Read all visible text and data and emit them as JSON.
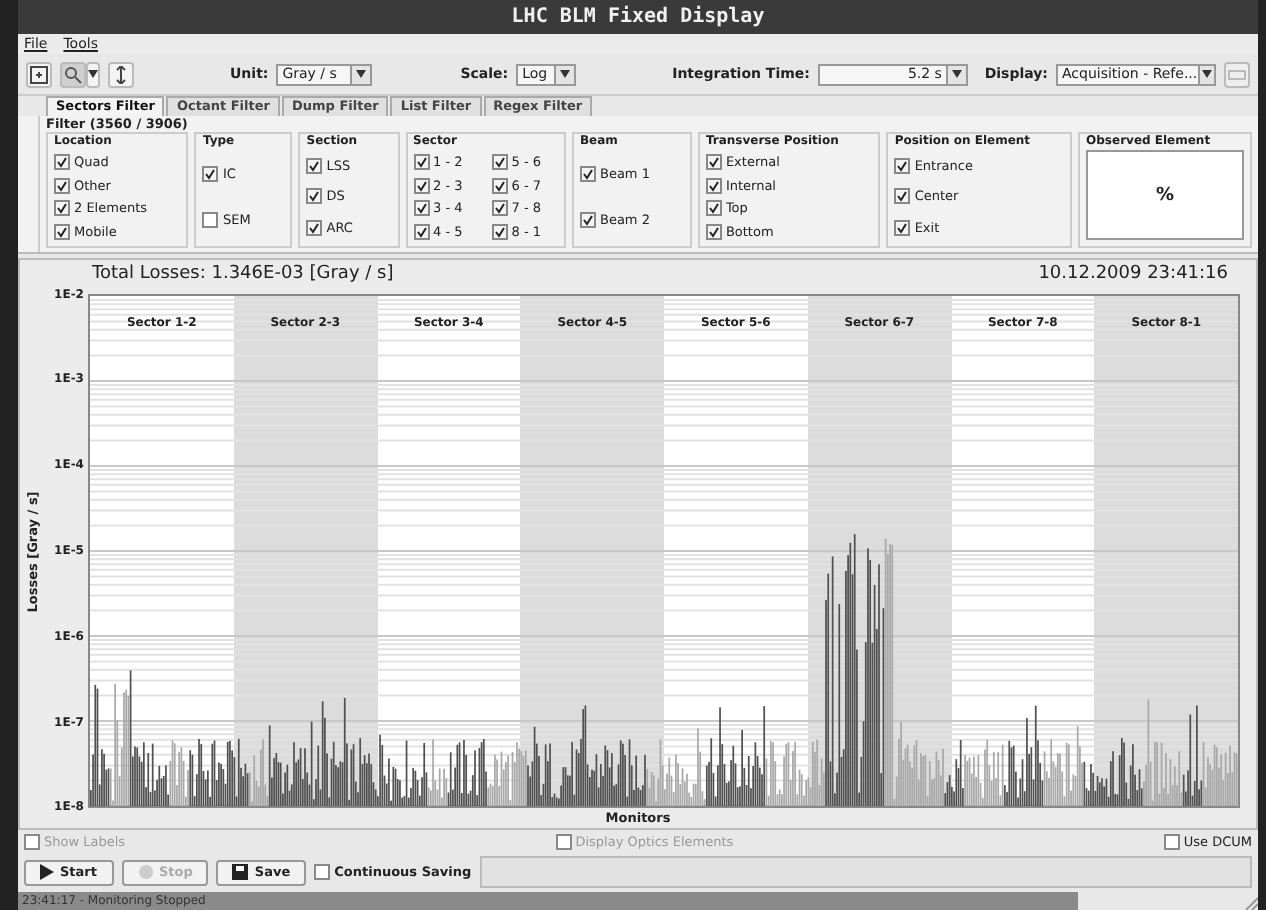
{
  "window": {
    "title": "LHC BLM Fixed Display"
  },
  "menu": [
    "File",
    "Tools"
  ],
  "toolbar": {
    "unit_label": "Unit:",
    "unit": "Gray / s",
    "scale_label": "Scale:",
    "scale": "Log",
    "integration_label": "Integration Time:",
    "integration": "5.2 s",
    "display_label": "Display:",
    "display": "Acquisition - Refe..."
  },
  "tabs": [
    {
      "label": "Sectors Filter",
      "selected": true
    },
    {
      "label": "Octant Filter",
      "selected": false
    },
    {
      "label": "Dump Filter",
      "selected": false
    },
    {
      "label": "List Filter",
      "selected": false
    },
    {
      "label": "Regex Filter",
      "selected": false
    }
  ],
  "filter": {
    "title": "Filter (3560 / 3906)",
    "groups": [
      {
        "kind": "checks",
        "title": "Location",
        "items": [
          {
            "label": "Quad",
            "checked": true
          },
          {
            "label": "Other",
            "checked": true
          },
          {
            "label": "2 Elements",
            "checked": true
          },
          {
            "label": "Mobile",
            "checked": true
          }
        ]
      },
      {
        "kind": "checks",
        "title": "Type",
        "items": [
          {
            "label": "IC",
            "checked": true
          },
          {
            "label": "SEM",
            "checked": false
          }
        ]
      },
      {
        "kind": "checks",
        "title": "Section",
        "items": [
          {
            "label": "LSS",
            "checked": true
          },
          {
            "label": "DS",
            "checked": true
          },
          {
            "label": "ARC",
            "checked": true
          }
        ]
      },
      {
        "kind": "checks",
        "title": "Sector",
        "items": [
          {
            "label": "1 - 2",
            "checked": true
          },
          {
            "label": "2 - 3",
            "checked": true
          },
          {
            "label": "3 - 4",
            "checked": true
          },
          {
            "label": "4 - 5",
            "checked": true
          },
          {
            "label": "5 - 6",
            "checked": true
          },
          {
            "label": "6 - 7",
            "checked": true
          },
          {
            "label": "7 - 8",
            "checked": true
          },
          {
            "label": "8 - 1",
            "checked": true
          }
        ]
      },
      {
        "kind": "checks",
        "title": "Beam",
        "items": [
          {
            "label": "Beam 1",
            "checked": true
          },
          {
            "label": "Beam 2",
            "checked": true
          }
        ]
      },
      {
        "kind": "checks",
        "title": "Transverse Position",
        "items": [
          {
            "label": "External",
            "checked": true
          },
          {
            "label": "Internal",
            "checked": true
          },
          {
            "label": "Top",
            "checked": true
          },
          {
            "label": "Bottom",
            "checked": true
          }
        ]
      },
      {
        "kind": "checks",
        "title": "Position on Element",
        "items": [
          {
            "label": "Entrance",
            "checked": true
          },
          {
            "label": "Center",
            "checked": true
          },
          {
            "label": "Exit",
            "checked": true
          }
        ]
      },
      {
        "kind": "text",
        "title": "Observed Element",
        "value": "%"
      }
    ]
  },
  "chart": {
    "total": "Total Losses: 1.346E-03 [Gray / s]",
    "timestamp": "10.12.2009 23:41:16",
    "ylabel": "Losses [Gray / s]",
    "xlabel": "Monitors",
    "yticks": [
      "1E-2",
      "1E-3",
      "1E-4",
      "1E-5",
      "1E-6",
      "1E-7",
      "1E-8"
    ],
    "sectors": [
      "Sector 1-2",
      "Sector 2-3",
      "Sector 3-4",
      "Sector 4-5",
      "Sector 5-6",
      "Sector 6-7",
      "Sector 7-8",
      "Sector 8-1"
    ]
  },
  "options": [
    {
      "label": "Show Labels",
      "checked": false,
      "disabled": true
    },
    {
      "label": "Display Optics Elements",
      "checked": false,
      "disabled": true
    },
    {
      "label": "Use DCUM",
      "checked": false,
      "disabled": false
    }
  ],
  "buttons": [
    {
      "kind": "start",
      "label": "Start",
      "disabled": false
    },
    {
      "kind": "stop",
      "label": "Stop",
      "disabled": true
    },
    {
      "kind": "save",
      "label": "Save",
      "disabled": false
    }
  ],
  "continuous_saving": {
    "label": "Continuous Saving",
    "checked": false
  },
  "status": "23:41:17 - Monitoring Stopped"
}
